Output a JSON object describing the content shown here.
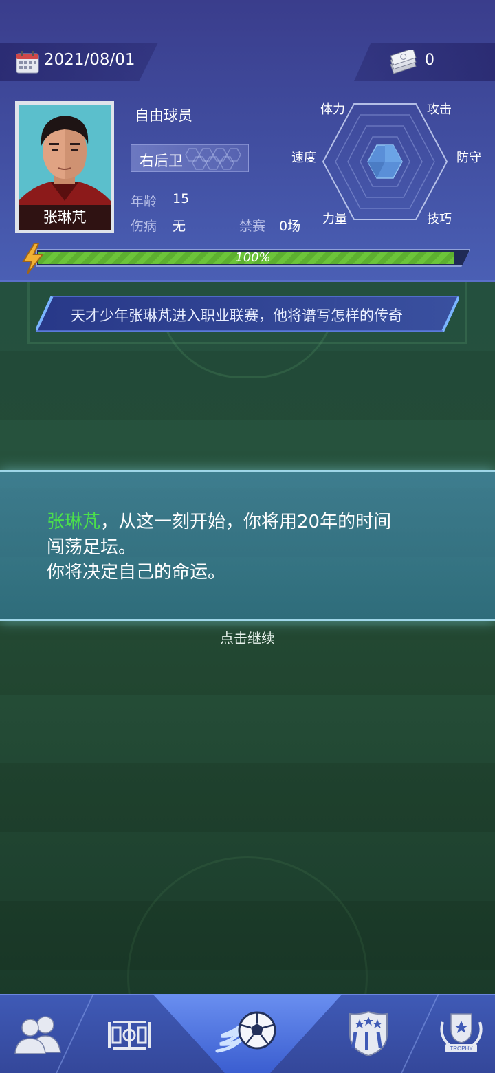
{
  "header": {
    "date": "2021/08/01",
    "money": "0",
    "player": {
      "name": "张琳芃",
      "status": "自由球员",
      "position": "右后卫",
      "age_label": "年龄",
      "age_value": "15",
      "injury_label": "伤病",
      "injury_value": "无",
      "ban_label": "禁赛",
      "ban_value": "0场"
    },
    "radar_labels": {
      "stamina": "体力",
      "attack": "攻击",
      "speed": "速度",
      "defense": "防守",
      "strength": "力量",
      "skill": "技巧"
    },
    "energy": {
      "label": "100%",
      "fraction": 1.0
    }
  },
  "headline": {
    "text": "天才少年张琳芃进入职业联赛，他将谱写怎样的传奇"
  },
  "message": {
    "name": "张琳芃",
    "line1_rest": "，从这一刻开始，你将用20年的时间",
    "line2": "闯荡足坛。",
    "line3": "你将决定自己的命运。"
  },
  "continue_hint": "点击继续",
  "nav": {
    "items": [
      "team-icon",
      "pitch-icon",
      "football-icon",
      "club-badge-icon",
      "trophy-icon"
    ],
    "trophy_caption": "TROPHY"
  },
  "colors": {
    "header_top": "#3a3d8c",
    "highlight_name": "#4be04b",
    "energy_fill": "#6cc43a",
    "nav_bg": "#3f5ab6"
  }
}
